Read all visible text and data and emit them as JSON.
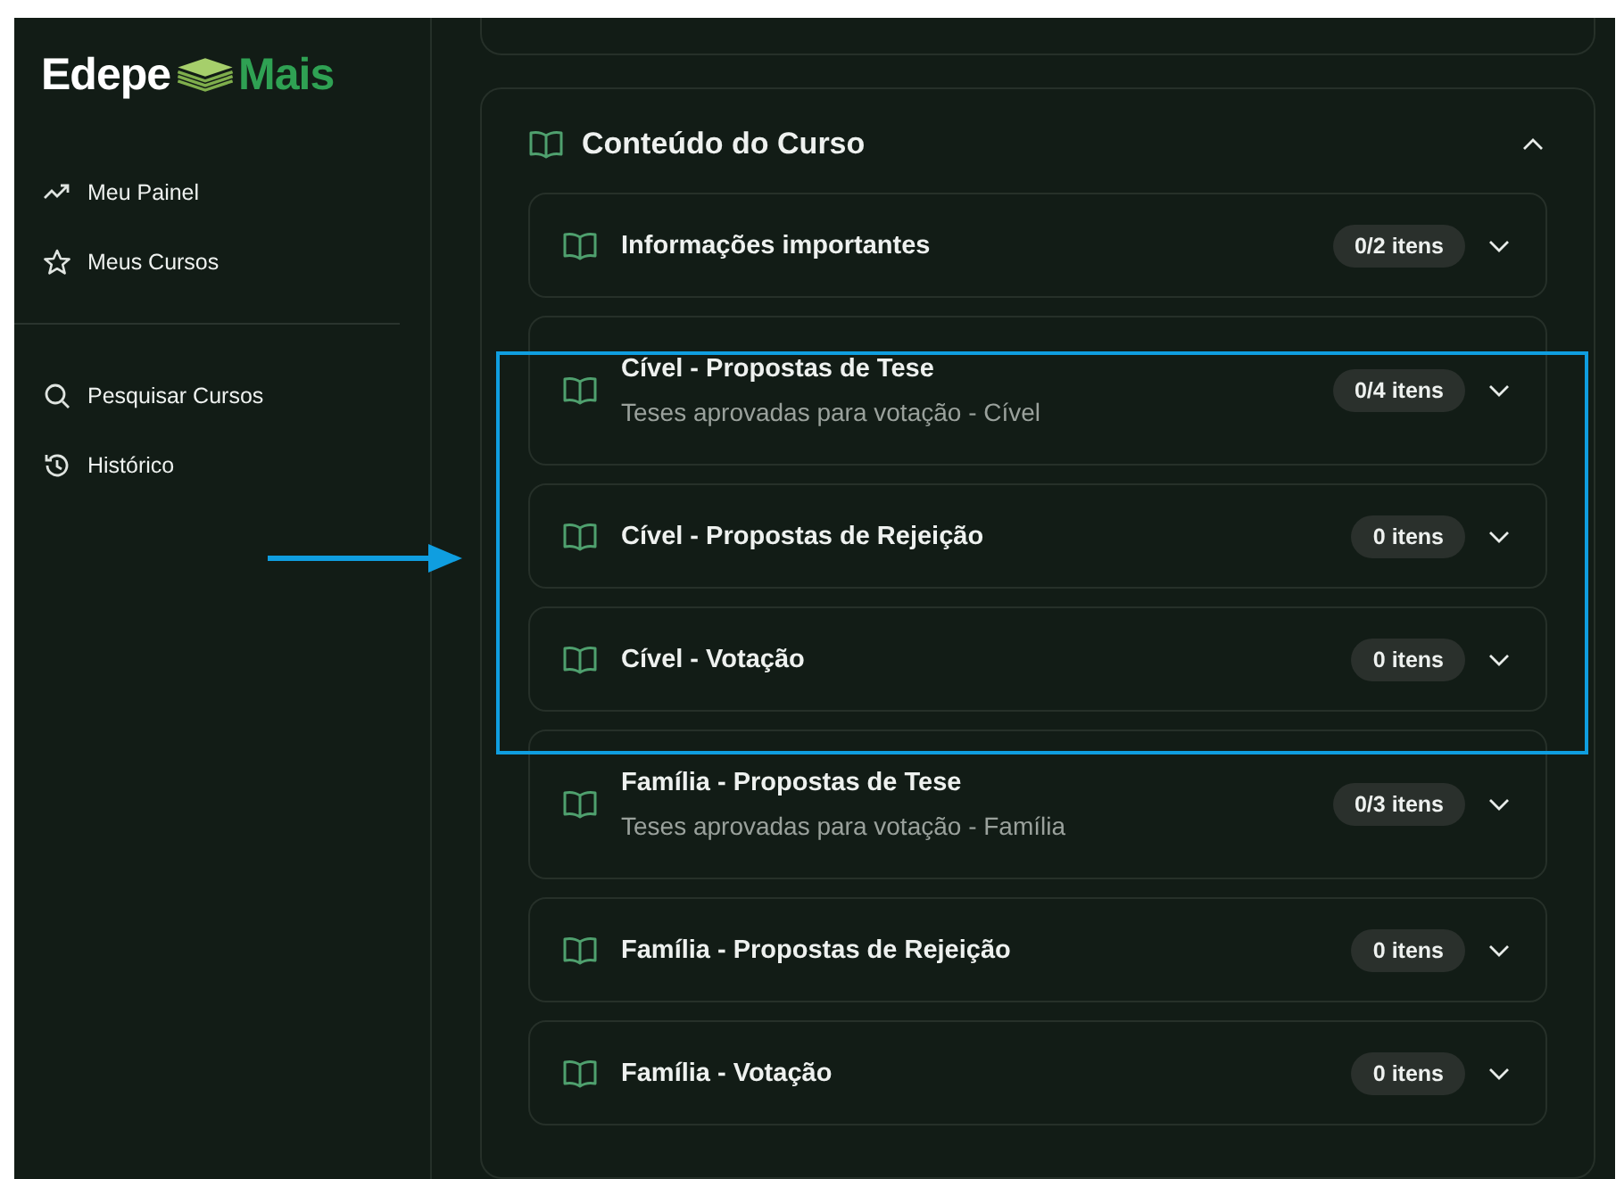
{
  "logo": {
    "first": "Edepe",
    "second": "Mais"
  },
  "sidebar": {
    "groups": [
      [
        {
          "label": "Meu Painel",
          "kind": "trend"
        },
        {
          "label": "Meus Cursos",
          "kind": "star"
        }
      ],
      [
        {
          "label": "Pesquisar Cursos",
          "kind": "search"
        },
        {
          "label": "Histórico",
          "kind": "history"
        }
      ]
    ]
  },
  "course_content": {
    "title": "Conteúdo do Curso",
    "expanded": true,
    "modules": [
      {
        "title": "Informações importantes",
        "count": "0/2 itens",
        "expanded": false
      },
      {
        "title": "Cível - Propostas de Tese",
        "subtitle": "Teses aprovadas para votação - Cível",
        "count": "0/4 itens",
        "expanded": false
      },
      {
        "title": "Cível - Propostas de Rejeição",
        "count": "0 itens",
        "expanded": false
      },
      {
        "title": "Cível - Votação",
        "count": "0 itens",
        "expanded": false
      },
      {
        "title": "Família - Propostas de Tese",
        "subtitle": "Teses aprovadas para votação - Família",
        "count": "0/3 itens",
        "expanded": false
      },
      {
        "title": "Família - Propostas de Rejeição",
        "count": "0 itens",
        "expanded": false
      },
      {
        "title": "Família - Votação",
        "count": "0 itens",
        "expanded": false
      }
    ]
  }
}
